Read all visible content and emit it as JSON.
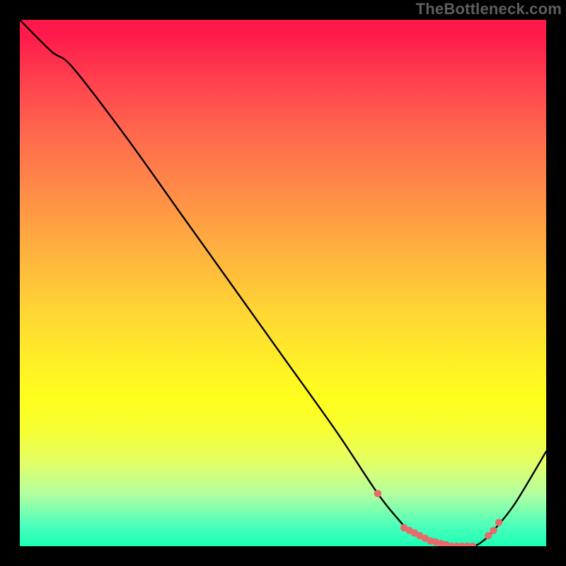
{
  "domain": "Chart",
  "watermark": "TheBottleneck.com",
  "colors": {
    "gradient_top": "#ff1a4b",
    "gradient_mid_orange": "#ff8a48",
    "gradient_mid_yellow": "#fff126",
    "gradient_bottom": "#1affb6",
    "curve": "#000000",
    "marker": "#e86a6a",
    "background": "#000000"
  },
  "chart_data": {
    "type": "line",
    "title": "",
    "xlabel": "",
    "ylabel": "",
    "xlim": [
      0,
      100
    ],
    "ylim": [
      0,
      100
    ],
    "grid": false,
    "legend": false,
    "series": [
      {
        "name": "bottleneck-curve",
        "x": [
          0,
          6,
          10,
          20,
          30,
          40,
          50,
          60,
          68,
          72,
          74,
          78,
          82,
          86,
          88,
          90,
          94,
          100
        ],
        "y": [
          100,
          94,
          91,
          78,
          64,
          50,
          36,
          22,
          10,
          5,
          3,
          1,
          0,
          0,
          1,
          3,
          8,
          18
        ]
      }
    ],
    "markers": {
      "name": "highlighted-points",
      "x": [
        68,
        73,
        74,
        75,
        76,
        77,
        78,
        79,
        80,
        81,
        82,
        83,
        84,
        85,
        86,
        89,
        90,
        91
      ],
      "y": [
        10,
        3.5,
        3,
        2.5,
        2,
        1.5,
        1,
        0.8,
        0.5,
        0.3,
        0,
        0,
        0,
        0,
        0,
        2,
        3,
        4.5
      ]
    }
  }
}
